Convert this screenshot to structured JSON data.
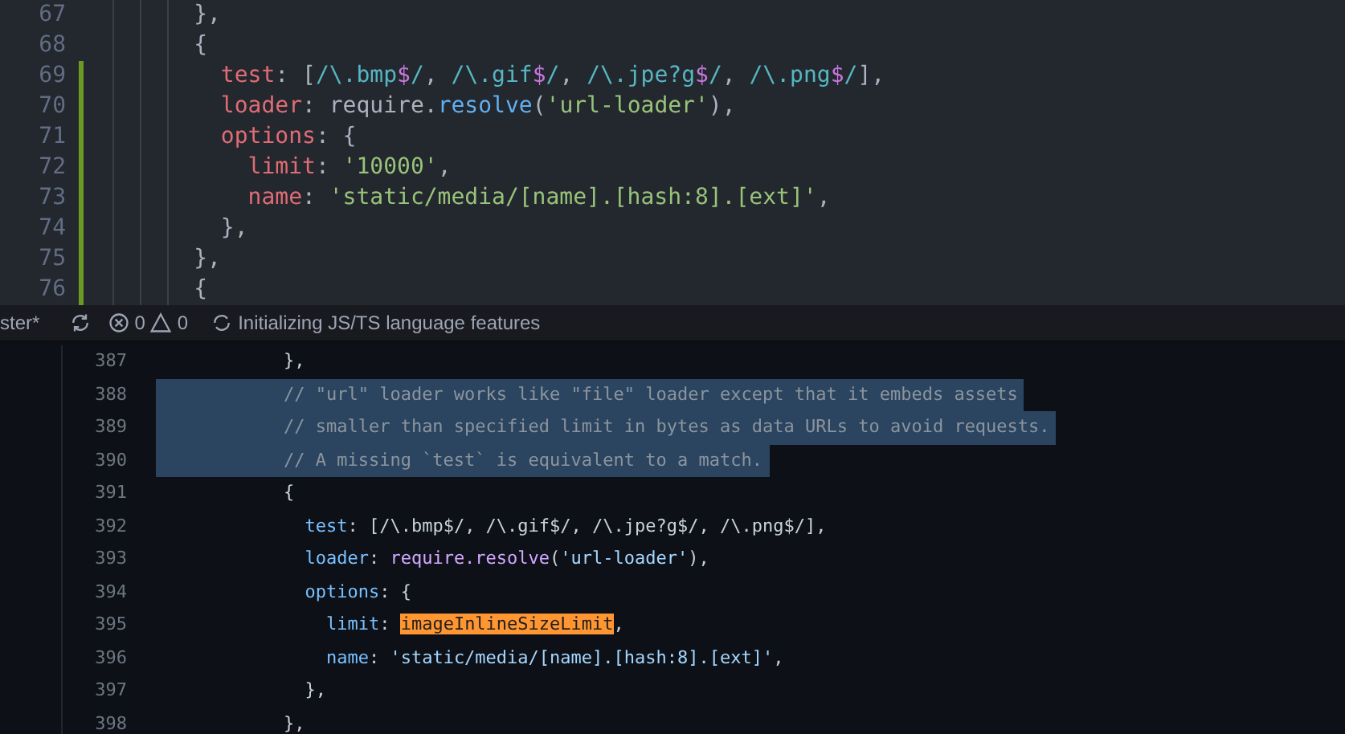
{
  "top_editor": {
    "lines": [
      {
        "number": "67",
        "modified": false,
        "tokens": [
          {
            "kind": "plain",
            "text": "      },"
          }
        ]
      },
      {
        "number": "68",
        "modified": false,
        "tokens": [
          {
            "kind": "plain",
            "text": "      {"
          }
        ]
      },
      {
        "number": "69",
        "modified": true,
        "tokens": [
          {
            "kind": "property",
            "text": "        test"
          },
          {
            "kind": "plain",
            "text": ": ["
          },
          {
            "kind": "regex",
            "text": "/\\.bmp"
          },
          {
            "kind": "anchor",
            "text": "$"
          },
          {
            "kind": "regex",
            "text": "/"
          },
          {
            "kind": "plain",
            "text": ", "
          },
          {
            "kind": "regex",
            "text": "/\\.gif"
          },
          {
            "kind": "anchor",
            "text": "$"
          },
          {
            "kind": "regex",
            "text": "/"
          },
          {
            "kind": "plain",
            "text": ", "
          },
          {
            "kind": "regex",
            "text": "/\\.jpe?g"
          },
          {
            "kind": "anchor",
            "text": "$"
          },
          {
            "kind": "regex",
            "text": "/"
          },
          {
            "kind": "plain",
            "text": ", "
          },
          {
            "kind": "regex",
            "text": "/\\.png"
          },
          {
            "kind": "anchor",
            "text": "$"
          },
          {
            "kind": "regex",
            "text": "/"
          },
          {
            "kind": "plain",
            "text": "],"
          }
        ]
      },
      {
        "number": "70",
        "modified": true,
        "tokens": [
          {
            "kind": "property",
            "text": "        loader"
          },
          {
            "kind": "plain",
            "text": ": require."
          },
          {
            "kind": "function",
            "text": "resolve"
          },
          {
            "kind": "plain",
            "text": "("
          },
          {
            "kind": "string",
            "text": "'url-loader'"
          },
          {
            "kind": "plain",
            "text": "),"
          }
        ]
      },
      {
        "number": "71",
        "modified": true,
        "tokens": [
          {
            "kind": "property",
            "text": "        options"
          },
          {
            "kind": "plain",
            "text": ": {"
          }
        ]
      },
      {
        "number": "72",
        "modified": true,
        "tokens": [
          {
            "kind": "property",
            "text": "          limit"
          },
          {
            "kind": "plain",
            "text": ": "
          },
          {
            "kind": "string",
            "text": "'10000'"
          },
          {
            "kind": "plain",
            "text": ","
          }
        ]
      },
      {
        "number": "73",
        "modified": true,
        "tokens": [
          {
            "kind": "property",
            "text": "          name"
          },
          {
            "kind": "plain",
            "text": ": "
          },
          {
            "kind": "string",
            "text": "'static/media/[name].[hash:8].[ext]'"
          },
          {
            "kind": "plain",
            "text": ","
          }
        ]
      },
      {
        "number": "74",
        "modified": true,
        "tokens": [
          {
            "kind": "plain",
            "text": "        },"
          }
        ]
      },
      {
        "number": "75",
        "modified": true,
        "tokens": [
          {
            "kind": "plain",
            "text": "      },"
          }
        ]
      },
      {
        "number": "76",
        "modified": true,
        "tokens": [
          {
            "kind": "plain",
            "text": "      {"
          }
        ]
      }
    ]
  },
  "status_bar": {
    "branch": "ster*",
    "errors": "0",
    "warnings": "0",
    "message": "Initializing JS/TS language features"
  },
  "bottom_view": {
    "lines": [
      {
        "number": "387",
        "selected": false,
        "tokens": [
          {
            "kind": "plain",
            "text": "            },"
          }
        ]
      },
      {
        "number": "388",
        "selected": true,
        "tokens": [
          {
            "kind": "comment",
            "text": "            // \"url\" loader works like \"file\" loader except that it embeds assets"
          }
        ]
      },
      {
        "number": "389",
        "selected": true,
        "tokens": [
          {
            "kind": "comment",
            "text": "            // smaller than specified limit in bytes as data URLs to avoid requests."
          }
        ]
      },
      {
        "number": "390",
        "selected": true,
        "tokens": [
          {
            "kind": "comment",
            "text": "            // A missing `test` is equivalent to a match."
          }
        ]
      },
      {
        "number": "391",
        "selected": false,
        "tokens": [
          {
            "kind": "plain",
            "text": "            {"
          }
        ]
      },
      {
        "number": "392",
        "selected": false,
        "tokens": [
          {
            "kind": "property",
            "text": "              test"
          },
          {
            "kind": "plain",
            "text": ": [/\\.bmp$/, /\\.gif$/, /\\.jpe?g$/, /\\.png$/],"
          }
        ]
      },
      {
        "number": "393",
        "selected": false,
        "tokens": [
          {
            "kind": "property",
            "text": "              loader"
          },
          {
            "kind": "plain",
            "text": ": "
          },
          {
            "kind": "function",
            "text": "require.resolve"
          },
          {
            "kind": "plain",
            "text": "("
          },
          {
            "kind": "string",
            "text": "'url-loader'"
          },
          {
            "kind": "plain",
            "text": "),"
          }
        ]
      },
      {
        "number": "394",
        "selected": false,
        "tokens": [
          {
            "kind": "property",
            "text": "              options"
          },
          {
            "kind": "plain",
            "text": ": {"
          }
        ]
      },
      {
        "number": "395",
        "selected": false,
        "tokens": [
          {
            "kind": "property",
            "text": "                limit"
          },
          {
            "kind": "plain",
            "text": ": "
          },
          {
            "kind": "match",
            "text": "imageInlineSizeLimit"
          },
          {
            "kind": "plain",
            "text": ","
          }
        ]
      },
      {
        "number": "396",
        "selected": false,
        "tokens": [
          {
            "kind": "property",
            "text": "                name"
          },
          {
            "kind": "plain",
            "text": ": "
          },
          {
            "kind": "string",
            "text": "'static/media/[name].[hash:8].[ext]'"
          },
          {
            "kind": "plain",
            "text": ","
          }
        ]
      },
      {
        "number": "397",
        "selected": false,
        "tokens": [
          {
            "kind": "plain",
            "text": "              },"
          }
        ]
      },
      {
        "number": "398",
        "selected": false,
        "tokens": [
          {
            "kind": "plain",
            "text": "            },"
          }
        ]
      }
    ]
  }
}
